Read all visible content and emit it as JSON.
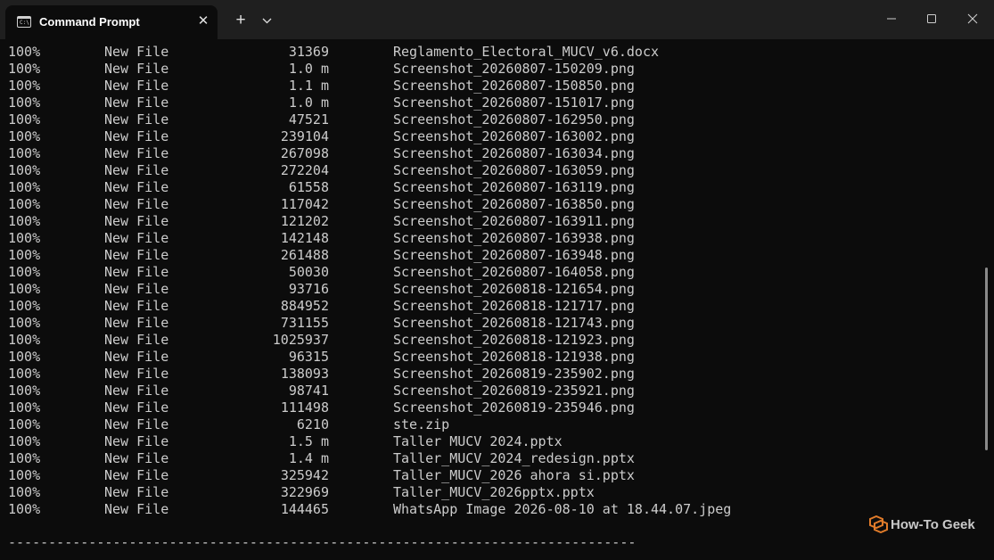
{
  "window": {
    "tab_title": "Command Prompt",
    "tab_icon": "cmd-icon",
    "new_tab_label": "+",
    "close_tab_label": "✕"
  },
  "terminal": {
    "rows": [
      {
        "pct": "100%",
        "type": "New File",
        "size": "31369",
        "name": "Reglamento_Electoral_MUCV_v6.docx"
      },
      {
        "pct": "100%",
        "type": "New File",
        "size": "1.0 m",
        "name": "Screenshot_20260807-150209.png"
      },
      {
        "pct": "100%",
        "type": "New File",
        "size": "1.1 m",
        "name": "Screenshot_20260807-150850.png"
      },
      {
        "pct": "100%",
        "type": "New File",
        "size": "1.0 m",
        "name": "Screenshot_20260807-151017.png"
      },
      {
        "pct": "100%",
        "type": "New File",
        "size": "47521",
        "name": "Screenshot_20260807-162950.png"
      },
      {
        "pct": "100%",
        "type": "New File",
        "size": "239104",
        "name": "Screenshot_20260807-163002.png"
      },
      {
        "pct": "100%",
        "type": "New File",
        "size": "267098",
        "name": "Screenshot_20260807-163034.png"
      },
      {
        "pct": "100%",
        "type": "New File",
        "size": "272204",
        "name": "Screenshot_20260807-163059.png"
      },
      {
        "pct": "100%",
        "type": "New File",
        "size": "61558",
        "name": "Screenshot_20260807-163119.png"
      },
      {
        "pct": "100%",
        "type": "New File",
        "size": "117042",
        "name": "Screenshot_20260807-163850.png"
      },
      {
        "pct": "100%",
        "type": "New File",
        "size": "121202",
        "name": "Screenshot_20260807-163911.png"
      },
      {
        "pct": "100%",
        "type": "New File",
        "size": "142148",
        "name": "Screenshot_20260807-163938.png"
      },
      {
        "pct": "100%",
        "type": "New File",
        "size": "261488",
        "name": "Screenshot_20260807-163948.png"
      },
      {
        "pct": "100%",
        "type": "New File",
        "size": "50030",
        "name": "Screenshot_20260807-164058.png"
      },
      {
        "pct": "100%",
        "type": "New File",
        "size": "93716",
        "name": "Screenshot_20260818-121654.png"
      },
      {
        "pct": "100%",
        "type": "New File",
        "size": "884952",
        "name": "Screenshot_20260818-121717.png"
      },
      {
        "pct": "100%",
        "type": "New File",
        "size": "731155",
        "name": "Screenshot_20260818-121743.png"
      },
      {
        "pct": "100%",
        "type": "New File",
        "size": "1025937",
        "name": "Screenshot_20260818-121923.png"
      },
      {
        "pct": "100%",
        "type": "New File",
        "size": "96315",
        "name": "Screenshot_20260818-121938.png"
      },
      {
        "pct": "100%",
        "type": "New File",
        "size": "138093",
        "name": "Screenshot_20260819-235902.png"
      },
      {
        "pct": "100%",
        "type": "New File",
        "size": "98741",
        "name": "Screenshot_20260819-235921.png"
      },
      {
        "pct": "100%",
        "type": "New File",
        "size": "111498",
        "name": "Screenshot_20260819-235946.png"
      },
      {
        "pct": "100%",
        "type": "New File",
        "size": "6210",
        "name": "ste.zip"
      },
      {
        "pct": "100%",
        "type": "New File",
        "size": "1.5 m",
        "name": "Taller MUCV 2024.pptx"
      },
      {
        "pct": "100%",
        "type": "New File",
        "size": "1.4 m",
        "name": "Taller_MUCV_2024_redesign.pptx"
      },
      {
        "pct": "100%",
        "type": "New File",
        "size": "325942",
        "name": "Taller_MUCV_2026 ahora si.pptx"
      },
      {
        "pct": "100%",
        "type": "New File",
        "size": "322969",
        "name": "Taller_MUCV_2026pptx.pptx"
      },
      {
        "pct": "100%",
        "type": "New File",
        "size": "144465",
        "name": "WhatsApp Image 2026-08-10 at 18.44.07.jpeg"
      }
    ],
    "divider": "------------------------------------------------------------------------------"
  },
  "watermark": {
    "text": "How-To Geek",
    "icon": "how-to-geek-logo-icon",
    "accent": "#e07b2a"
  },
  "colors": {
    "background": "#0c0c0c",
    "titlebar": "#1f1f1f",
    "text": "#cccccc"
  }
}
